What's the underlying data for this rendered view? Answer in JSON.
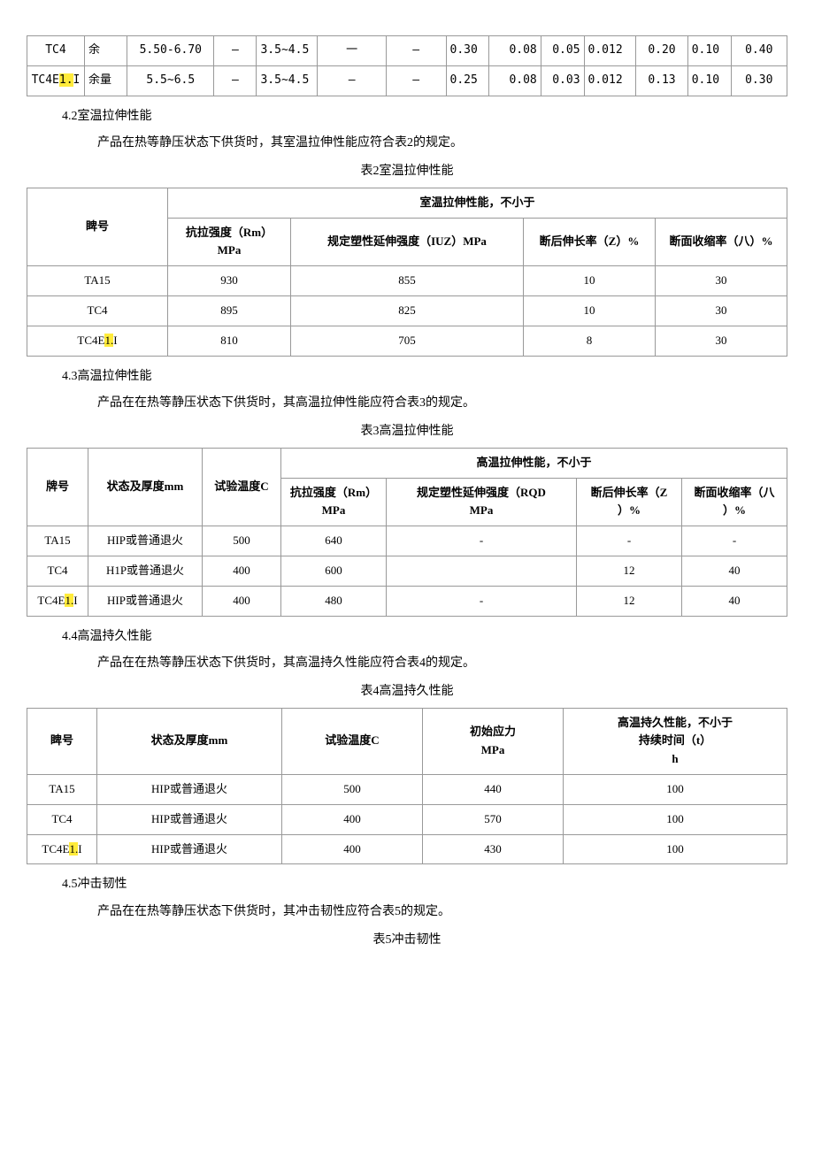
{
  "table1": {
    "rows": [
      {
        "c0": "TC4",
        "c1": "余",
        "c2": "5.50-6.70",
        "c3": "—",
        "c4": "3.5~4.5",
        "c5": "一",
        "c6": "—",
        "c7": "0.30",
        "c8": "0.08",
        "c9": "0.05",
        "c10": "0.012",
        "c11": "0.20",
        "c12": "0.10",
        "c13": "0.40"
      },
      {
        "c0": "TC4E",
        "c0b": "1.",
        "c0c": "I",
        "c1": "余量",
        "c2": "5.5~6.5",
        "c3": "—",
        "c4": "3.5~4.5",
        "c5": "—",
        "c6": "—",
        "c7": "0.25",
        "c8": "0.08",
        "c9": "0.03",
        "c10": "0.012",
        "c11": "0.13",
        "c12": "0.10",
        "c13": "0.30"
      }
    ]
  },
  "s42": {
    "title": "4.2室温拉伸性能",
    "body": "产品在热等静压状态下供货时，其室温拉伸性能应符合表2的规定。",
    "caption": "表2室温拉伸性能",
    "h_brand": "睥号",
    "h_group": "室温拉伸性能，不小于",
    "h_rm": "抗拉强度（Rm）",
    "h_rm2": "MPa",
    "h_iuz": "规定塑性延伸强度（IUZ）MPa",
    "h_z": "断后伸长率（Z）%",
    "h_psi": "断面收缩率（八）%",
    "rows": [
      {
        "brand": "TA15",
        "rm": "930",
        "iuz": "855",
        "z": "10",
        "psi": "30"
      },
      {
        "brand": "TC4",
        "rm": "895",
        "iuz": "825",
        "z": "10",
        "psi": "30"
      },
      {
        "brandA": "TC4E",
        "brandH": "1.",
        "brandC": "I",
        "rm": "810",
        "iuz": "705",
        "z": "8",
        "psi": "30"
      }
    ]
  },
  "s43": {
    "title": "4.3高温拉伸性能",
    "body": "产品在在热等静压状态下供货时，其高温拉伸性能应符合表3的规定。",
    "caption": "表3高温拉伸性能",
    "h_brand": "牌号",
    "h_state": "状态及厚度mm",
    "h_temp": "试验温度C",
    "h_group": "高温拉伸性能，不小于",
    "h_rm1": "抗拉强度（Rm）",
    "h_rm2": "MPa",
    "h_rqd1": "规定塑性延伸强度（RQD",
    "h_rqd2": "MPa",
    "h_z1": "断后伸长率（Z",
    "h_z2": "）%",
    "h_psi1": "断面收缩率（八",
    "h_psi2": "）%",
    "rows": [
      {
        "brand": "TA15",
        "state": "HIP或普通退火",
        "temp": "500",
        "rm": "640",
        "rqd": "-",
        "z": "-",
        "psi": "-"
      },
      {
        "brand": "TC4",
        "state": "H1P或普通退火",
        "temp": "400",
        "rm": "600",
        "rqd": "",
        "z": "12",
        "psi": "40"
      },
      {
        "brandA": "TC4E",
        "brandH": "1.",
        "brandC": "I",
        "state": "HIP或普通退火",
        "temp": "400",
        "rm": "480",
        "rqd": "-",
        "z": "12",
        "psi": "40"
      }
    ]
  },
  "s44": {
    "title": "4.4高温持久性能",
    "body": "产品在在热等静压状态下供货时，其高温持久性能应符合表4的规定。",
    "caption": "表4高温持久性能",
    "h_brand": "睥号",
    "h_state": "状态及厚度mm",
    "h_temp": "试验温度C",
    "h_init1": "初始应力",
    "h_init2": "MPa",
    "h_dur1": "高温持久性能，不小于",
    "h_dur2": "持续时间（t）",
    "h_dur3": "h",
    "rows": [
      {
        "brand": "TA15",
        "state": "HIP或普通退火",
        "temp": "500",
        "init": "440",
        "dur": "100"
      },
      {
        "brand": "TC4",
        "state": "HIP或普通退火",
        "temp": "400",
        "init": "570",
        "dur": "100"
      },
      {
        "brandA": "TC4E",
        "brandH": "1.",
        "brandC": "I",
        "state": "HIP或普通退火",
        "temp": "400",
        "init": "430",
        "dur": "100"
      }
    ]
  },
  "s45": {
    "title": "4.5冲击韧性",
    "body": "产品在在热等静压状态下供货时，其冲击韧性应符合表5的规定。",
    "caption": "表5冲击韧性"
  }
}
